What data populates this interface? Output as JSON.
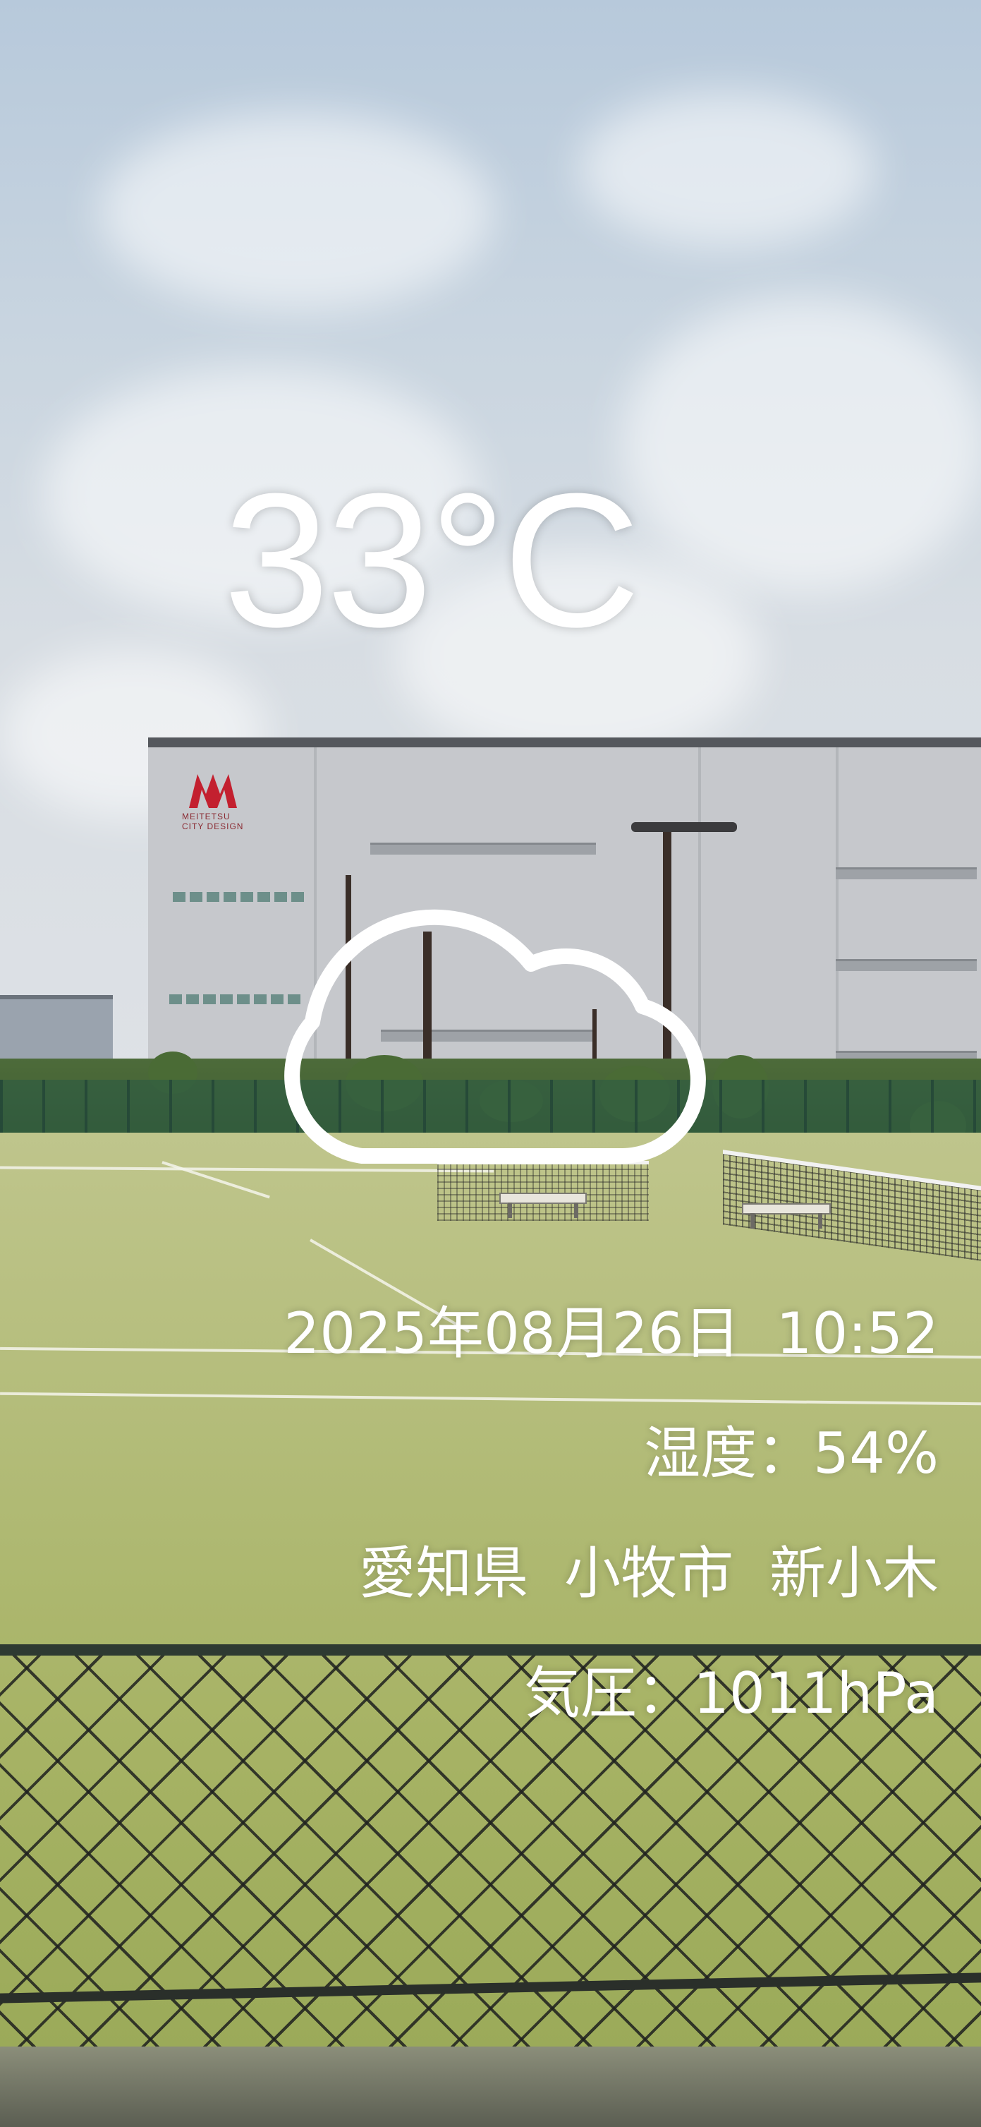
{
  "weather": {
    "temperature": "33°C",
    "condition_icon": "cloud-icon",
    "datetime": "2025年08月26日  10:52",
    "humidity": "湿度：54%",
    "location": "愛知県  小牧市  新小木",
    "pressure": "気圧：1011hPa"
  },
  "photo": {
    "building_logo_text": "MEITETSU CITY DESIGN"
  }
}
